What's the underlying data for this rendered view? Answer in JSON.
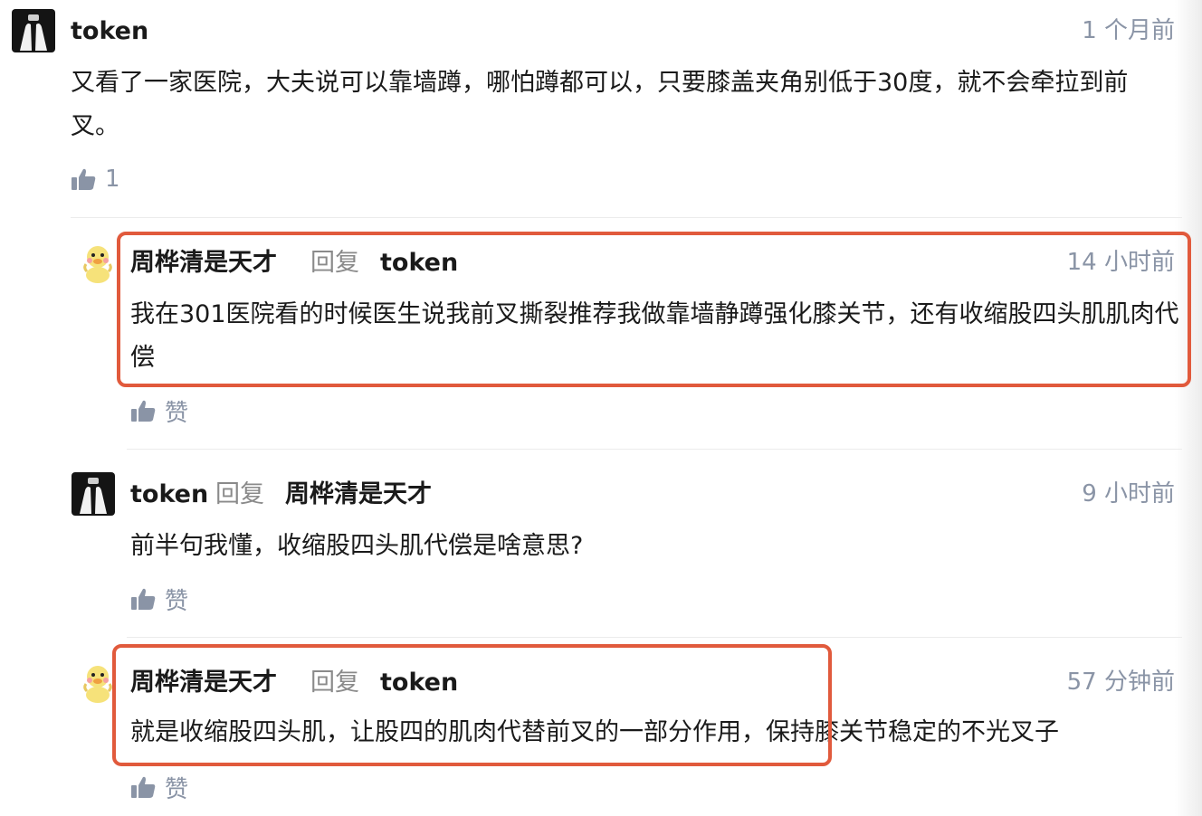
{
  "comment": {
    "author": "token",
    "time": "1 个月前",
    "text": "又看了一家医院，大夫说可以靠墙蹲，哪怕蹲都可以，只要膝盖夹角别低于30度，就不会牵拉到前叉。",
    "like_count": "1"
  },
  "replies": [
    {
      "author": "周桦清是天才",
      "reply_word": "回复",
      "reply_to": "token",
      "time": "14 小时前",
      "text": "我在301医院看的时候医生说我前叉撕裂推荐我做靠墙静蹲强化膝关节，还有收缩股四头肌肌肉代偿",
      "like_label": "赞"
    },
    {
      "author": "token",
      "reply_word": "回复",
      "reply_to": "周桦清是天才",
      "time": "9 小时前",
      "text": "前半句我懂，收缩股四头肌代偿是啥意思?",
      "like_label": "赞"
    },
    {
      "author": "周桦清是天才",
      "reply_word": "回复",
      "reply_to": "token",
      "time": "57 分钟前",
      "text": "就是收缩股四头肌，让股四的肌肉代替前叉的一部分作用，保持膝关节稳定的不光叉子",
      "like_label": "赞"
    }
  ],
  "colors": {
    "highlight": "#e15a3c",
    "meta": "#8a94a6"
  }
}
